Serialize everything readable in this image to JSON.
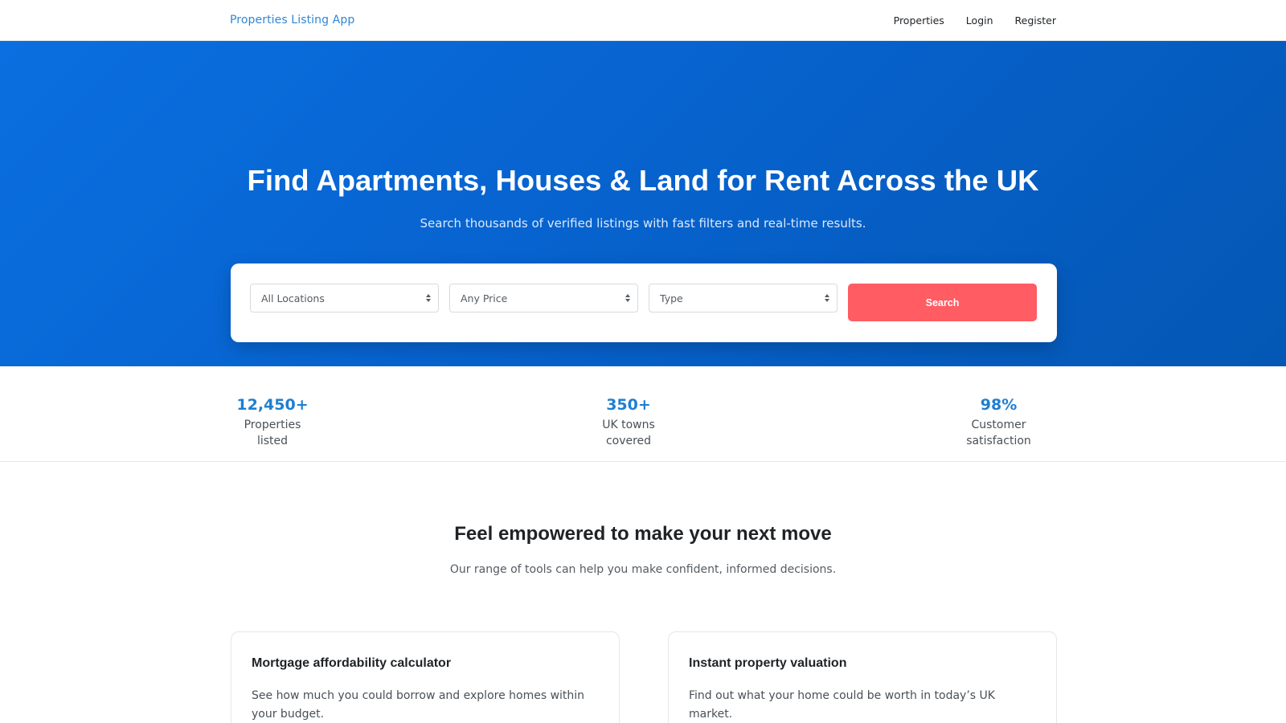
{
  "navbar": {
    "brand": "Properties Listing App",
    "links": [
      "Properties",
      "Login",
      "Register"
    ]
  },
  "hero": {
    "title": "Find Apartments, Houses & Land for Rent Across the UK",
    "subtitle": "Search thousands of verified listings with fast filters and real-time results."
  },
  "search": {
    "location_value": "All Locations",
    "price_value": "Any Price",
    "type_value": "Type",
    "button_label": "Search"
  },
  "stats": [
    {
      "value": "12,450+",
      "label": "Properties listed"
    },
    {
      "value": "350+",
      "label": "UK towns covered"
    },
    {
      "value": "98%",
      "label": "Customer satisfaction"
    }
  ],
  "tools": {
    "title": "Feel empowered to make your next move",
    "subtitle": "Our range of tools can help you make confident, informed decisions.",
    "cards": [
      {
        "title": "Mortgage affordability calculator",
        "text": "See how much you could borrow and explore homes within your budget."
      },
      {
        "title": "Instant property valuation",
        "text": "Find out what your home could be worth in today’s UK market."
      }
    ]
  },
  "colors": {
    "brand": "#2f86d6",
    "hero_blue": "#0763cf",
    "search_button": "#ff5c63",
    "stat_value": "#1f7fd1"
  }
}
